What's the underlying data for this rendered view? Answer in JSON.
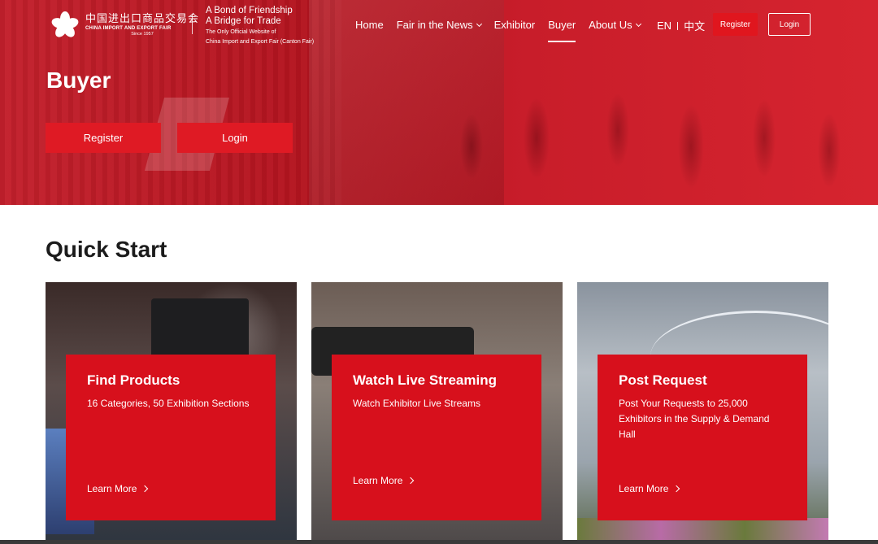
{
  "header": {
    "logo": {
      "chinese": "中国进出口商品交易会",
      "english": "CHINA IMPORT AND EXPORT FAIR",
      "since": "Since 1957"
    },
    "tagline": {
      "line1": "A Bond of Friendship",
      "line2": "A Bridge for Trade",
      "sub1": "The Only Official Website of",
      "sub2": "China Import and Export Fair (Canton Fair)"
    },
    "nav": [
      {
        "label": "Home"
      },
      {
        "label": "Fair in the News"
      },
      {
        "label": "Exhibitor"
      },
      {
        "label": "Buyer"
      },
      {
        "label": "About Us"
      }
    ],
    "lang": {
      "en": "EN",
      "zh": "中文"
    },
    "register_label": "Register",
    "login_label": "Login"
  },
  "hero": {
    "title": "Buyer",
    "register_label": "Register",
    "login_label": "Login"
  },
  "quick_start": {
    "title": "Quick Start",
    "cards": [
      {
        "title": "Find Products",
        "desc": "16 Categories, 50 Exhibition Sections",
        "link": "Learn More"
      },
      {
        "title": "Watch Live Streaming",
        "desc": "Watch Exhibitor Live Streams",
        "link": "Learn More"
      },
      {
        "title": "Post Request",
        "desc": "Post Your Requests to 25,000 Exhibitors in the Supply & Demand Hall",
        "link": "Learn More"
      }
    ]
  },
  "colors": {
    "brand_red": "#d7101c",
    "hero_red": "#c81d2a"
  }
}
